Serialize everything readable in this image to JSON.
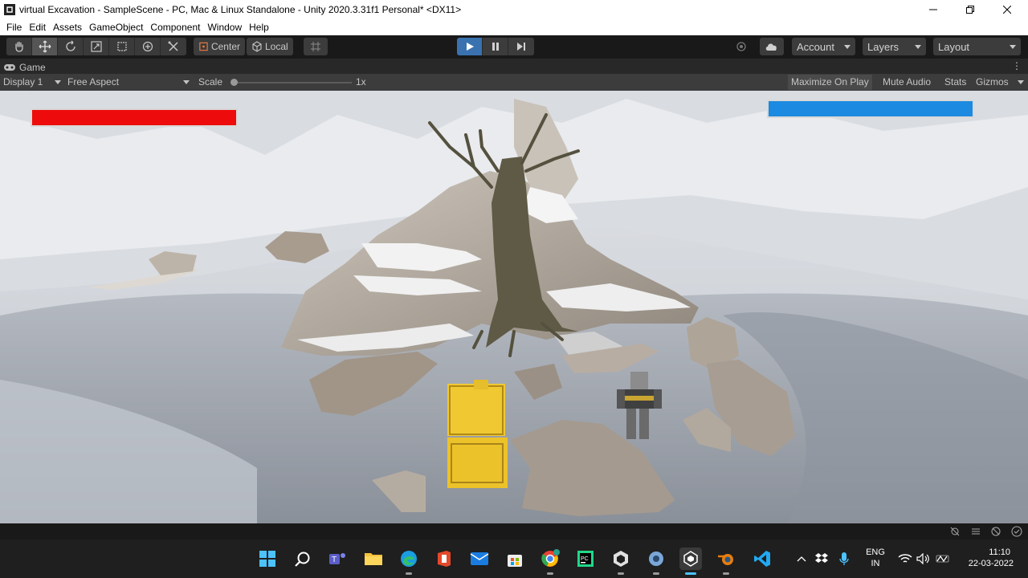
{
  "window": {
    "title": "virtual Excavation - SampleScene - PC, Mac & Linux Standalone - Unity 2020.3.31f1 Personal* <DX11>"
  },
  "menu": [
    "File",
    "Edit",
    "Assets",
    "GameObject",
    "Component",
    "Window",
    "Help"
  ],
  "toolbar": {
    "pivot_label": "Center",
    "space_label": "Local",
    "account_label": "Account",
    "layers_label": "Layers",
    "layout_label": "Layout"
  },
  "game_tab": {
    "label": "Game"
  },
  "game_toolbar": {
    "display": "Display 1",
    "aspect": "Free Aspect",
    "scale_label": "Scale",
    "scale_value": "1x",
    "maximize": "Maximize On Play",
    "mute": "Mute Audio",
    "stats": "Stats",
    "gizmos": "Gizmos"
  },
  "hud": {
    "player_health_color": "#ee0b0b",
    "enemy_health_color": "#1b8ae0"
  },
  "taskbar": {
    "apps": [
      "start-icon",
      "search-icon",
      "teams-icon",
      "file-explorer-icon",
      "edge-icon",
      "office-icon",
      "mail-icon",
      "store-icon",
      "chrome-icon",
      "pycharm-icon",
      "unity-hub-icon",
      "settings-icon",
      "unity-icon",
      "blender-icon",
      "vscode-icon"
    ],
    "lang_top": "ENG",
    "lang_bottom": "IN",
    "time": "11:10",
    "date": "22-03-2022"
  }
}
